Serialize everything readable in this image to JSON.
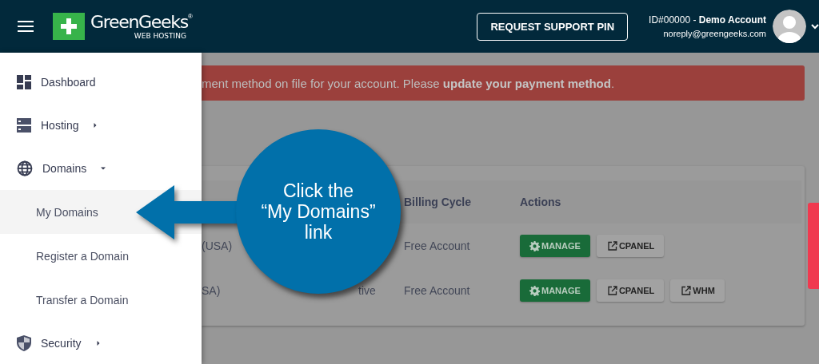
{
  "header": {
    "brand": {
      "name": "GreenGeeks",
      "trademark": "®",
      "tagline": "WEB HOSTING"
    },
    "support_button": "REQUEST SUPPORT PIN",
    "account": {
      "id_line": "ID#00000 - **Demo Account**",
      "email": "noreply@greengeeks.com"
    }
  },
  "sidebar": {
    "items": [
      {
        "label": "Dashboard"
      },
      {
        "label": "Hosting",
        "expanded": false
      },
      {
        "label": "Domains",
        "expanded": true,
        "children": [
          {
            "label": "My Domains",
            "selected": true
          },
          {
            "label": "Register a Domain",
            "selected": false
          },
          {
            "label": "Transfer a Domain",
            "selected": false
          }
        ]
      },
      {
        "label": "Security",
        "expanded": false
      }
    ]
  },
  "alert": {
    "text": "ment method on file for your account. Please **update your payment method**."
  },
  "table": {
    "columns": [
      {
        "label": "Billing Cycle"
      },
      {
        "label": "Actions"
      }
    ],
    "rows": [
      {
        "column_1": "(USA)",
        "billing_cycle": "Free Account",
        "actions": [
          {
            "kind": "manage",
            "label": "MANAGE"
          },
          {
            "kind": "external",
            "label": "CPANEL"
          }
        ]
      },
      {
        "column_1": "SA)",
        "column_2": "tive",
        "billing_cycle": "Free Account",
        "actions": [
          {
            "kind": "manage",
            "label": "MANAGE"
          },
          {
            "kind": "external",
            "label": "CPANEL"
          },
          {
            "kind": "external",
            "label": "WHM"
          }
        ]
      }
    ]
  },
  "callout": {
    "text": "Click the\n“My Domains”\nlink"
  }
}
